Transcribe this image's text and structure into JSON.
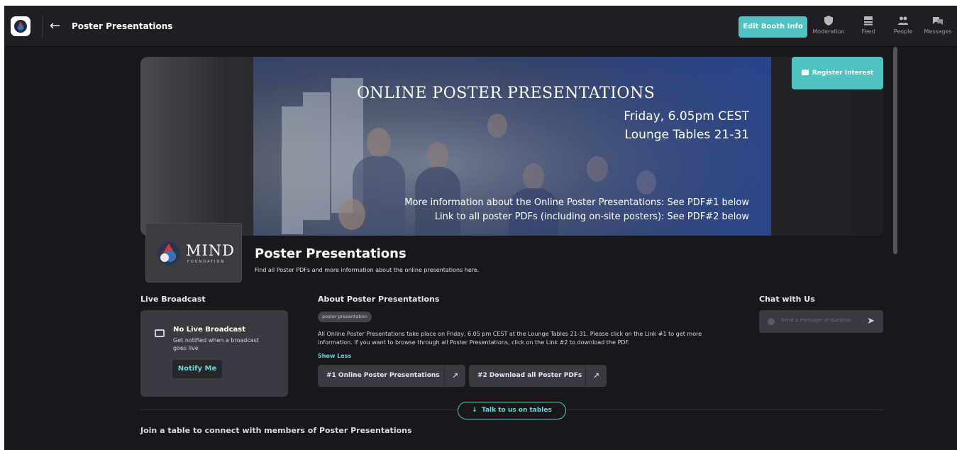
{
  "topbar": {
    "back_icon": "arrow-left-icon",
    "title": "Poster Presentations",
    "edit_button": "Edit Booth Info",
    "nav": [
      {
        "label": "Moderation",
        "icon": "shield-icon"
      },
      {
        "label": "Feed",
        "icon": "feed-icon"
      },
      {
        "label": "People",
        "icon": "people-icon"
      },
      {
        "label": "Messages",
        "icon": "messages-icon"
      }
    ]
  },
  "banner": {
    "headline": "ONLINE POSTER PRESENTATIONS",
    "line1": "Friday, 6.05pm CEST",
    "line2": "Lounge Tables 21-31",
    "info1": "More information about the Online Poster Presentations: See PDF#1 below",
    "info2": "Link to all poster PDFs (including on-site posters): See PDF#2 below",
    "register_button": "Register Interest"
  },
  "organization": {
    "logo_text": "MIND",
    "logo_sub": "FOUNDATION",
    "title": "Poster Presentations",
    "subtitle": "Find all Poster PDFs and more information about the online presentations here."
  },
  "live": {
    "heading": "Live Broadcast",
    "title": "No Live Broadcast",
    "desc": "Get notified when a broadcast goes live",
    "button": "Notify Me"
  },
  "about": {
    "heading": "About Poster Presentations",
    "tag": "poster presentation",
    "text": "All Online Poster Presentations take place on Friday, 6.05 pm CEST at the Lounge Tables 21-31. Please click on the Link #1 to get more information. If you want to browse through all Poster Presentations, click on the Link #2 to download the PDF.",
    "show_less": "Show Less",
    "links": [
      {
        "label": "#1 Online Poster Presentations",
        "icon": "external-link-icon"
      },
      {
        "label": "#2 Download all Poster PDFs",
        "icon": "external-link-icon"
      }
    ]
  },
  "chat": {
    "heading": "Chat with Us",
    "placeholder": "Send a message or question"
  },
  "tables": {
    "talk_button": "Talk to us on tables",
    "join_text": "Join a table to connect with members of Poster Presentations"
  },
  "colors": {
    "accent": "#4fc2c2",
    "background": "#18181c",
    "card": "#3a3a42"
  }
}
